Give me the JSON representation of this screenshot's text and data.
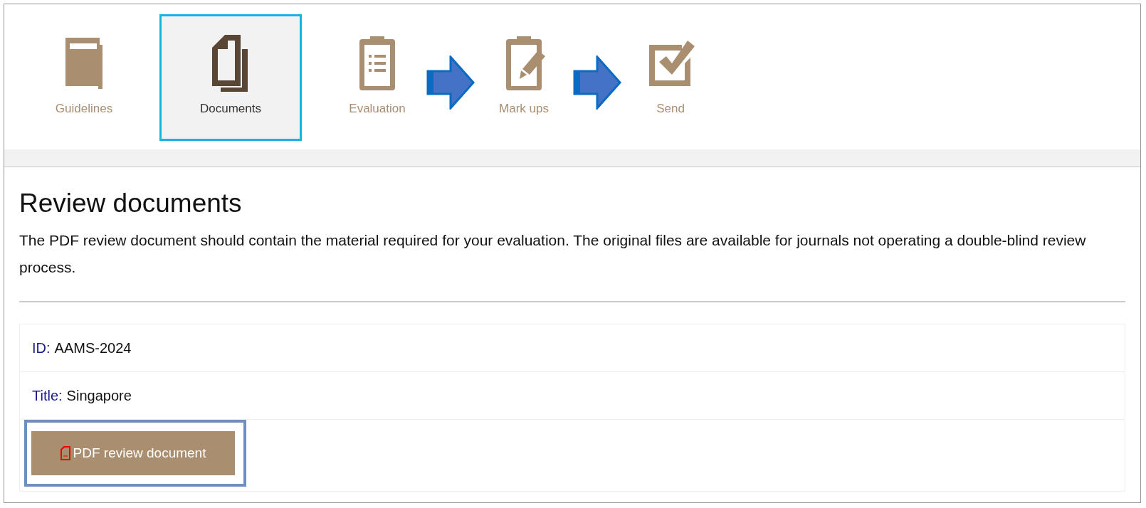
{
  "steps": [
    {
      "label": "Guidelines",
      "selected": false,
      "arrow_before": false
    },
    {
      "label": "Documents",
      "selected": true,
      "arrow_before": false
    },
    {
      "label": "Evaluation",
      "selected": false,
      "arrow_before": false
    },
    {
      "label": "Mark ups",
      "selected": false,
      "arrow_before": true
    },
    {
      "label": "Send",
      "selected": false,
      "arrow_before": true
    }
  ],
  "heading": "Review documents",
  "description": "The PDF review document should contain the material required for your evaluation. The original files are available for journals not operating a double-blind review process.",
  "details": [
    {
      "label": "ID:",
      "value": "AAMS-2024"
    },
    {
      "label": "Title:",
      "value": "Singapore"
    }
  ],
  "pdf_button": "PDF review document"
}
